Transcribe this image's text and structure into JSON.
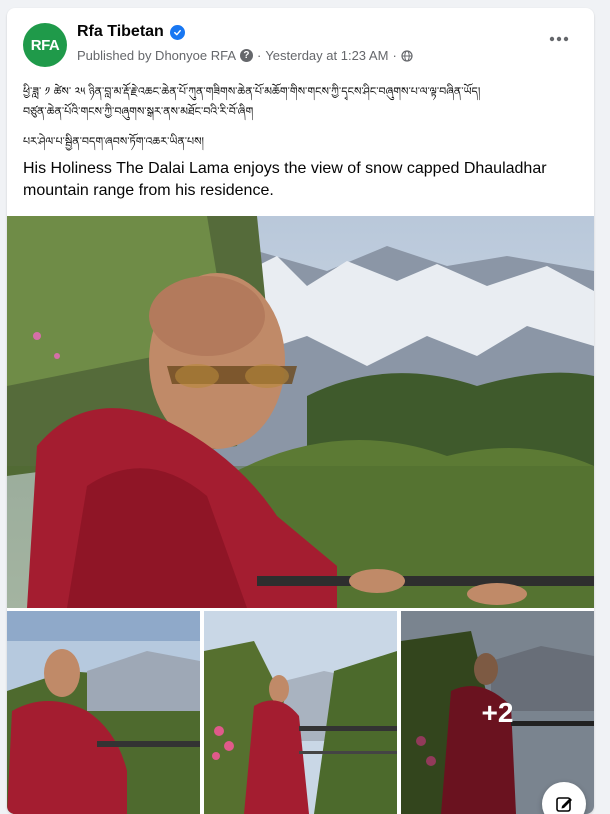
{
  "post": {
    "page_name": "Rfa Tibetan",
    "avatar_text": "RFA",
    "published_by": "Published by Dhonyoe RFA",
    "timestamp": "Yesterday at 1:23 AM",
    "separator": "·",
    "tibetan_line1": "ཕྱི་ཟླ་ ༡ ཚེས་ ༢༥ ཉིན་བླ་མ་རྡོ་རྗེ་འཆང་ཆེན་པོ་ཀུན་གཟིགས་ཆེན་པོ་མཆོག་གིས་གངས་ཀྱི་དྭངས་ཤིང་བཞུགས་པ་ལ་ལྟ་བཞིན་ཡོད།",
    "tibetan_line2": "བཙུན་ཆེན་པོའི་གངས་ཀྱི་བཞུགས་སྒར་ནས་མཐོང་བའི་རི་བོ་ཞིག",
    "tibetan_line3": "པར་ཤེལ་པ་སྦྱིན་བདག་ཞབས་ཏོག་འཆར་ཡིན་པས།",
    "english_text": "His Holiness The Dalai Lama enjoys the view of snow capped Dhauladhar mountain range from his residence.",
    "more_photos": "+2"
  },
  "icons": {
    "verified": "verified-badge-icon",
    "info": "info-question-icon",
    "globe": "globe-icon",
    "more": "more-options-icon",
    "edit": "edit-compose-icon"
  },
  "colors": {
    "brand_green": "#1f9a4a",
    "verified_blue": "#1877f2",
    "robe": "#9b1c2b",
    "sky": "#c7d4e3"
  }
}
